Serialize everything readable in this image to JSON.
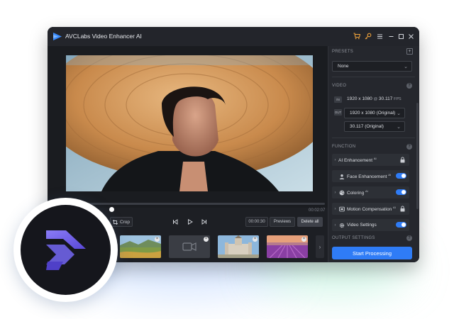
{
  "window": {
    "title": "AVCLabs Video Enhancer AI",
    "titlebar_icons": [
      "cart-icon",
      "key-icon",
      "menu-icon",
      "minimize-icon",
      "maximize-icon",
      "close-icon"
    ]
  },
  "player": {
    "time_total": "00:02:07",
    "current_time": "00:00:30",
    "crop_label": "Crop",
    "previews_label": "Previews",
    "delete_all_label": "Delete all"
  },
  "thumbnails": [
    "landscape",
    "video-placeholder",
    "church",
    "lavender-field"
  ],
  "panel": {
    "presets": {
      "title": "PRESETS",
      "value": "None"
    },
    "video": {
      "title": "VIDEO",
      "in_label": "IN",
      "in_resolution": "1920 x 1080",
      "in_at": "@",
      "in_fps": "30.117",
      "in_fps_unit": "FPS",
      "out_label": "OUT",
      "out_resolution": "1920 x 1080 (Original)",
      "out_fps": "30.117 (Original)"
    },
    "function": {
      "title": "FUNCTION",
      "items": [
        {
          "label": "AI Enhancement",
          "sup": "AI",
          "state": "locked"
        },
        {
          "label": "Face Enhancement",
          "sup": "AI",
          "state": "on"
        },
        {
          "label": "Coloring",
          "sup": "AI",
          "state": "on"
        },
        {
          "label": "Motion Compensation",
          "sup": "AI",
          "state": "locked"
        },
        {
          "label": "Video Settings",
          "sup": "",
          "state": "on"
        }
      ]
    },
    "output": {
      "title": "OUTPUT SETTINGS"
    },
    "start_label": "Start Processing"
  },
  "colors": {
    "accent": "#2f7cf6",
    "orange": "#f0a33c",
    "window_bg": "#1d1f24",
    "logo_purple": "#6f63e8"
  }
}
